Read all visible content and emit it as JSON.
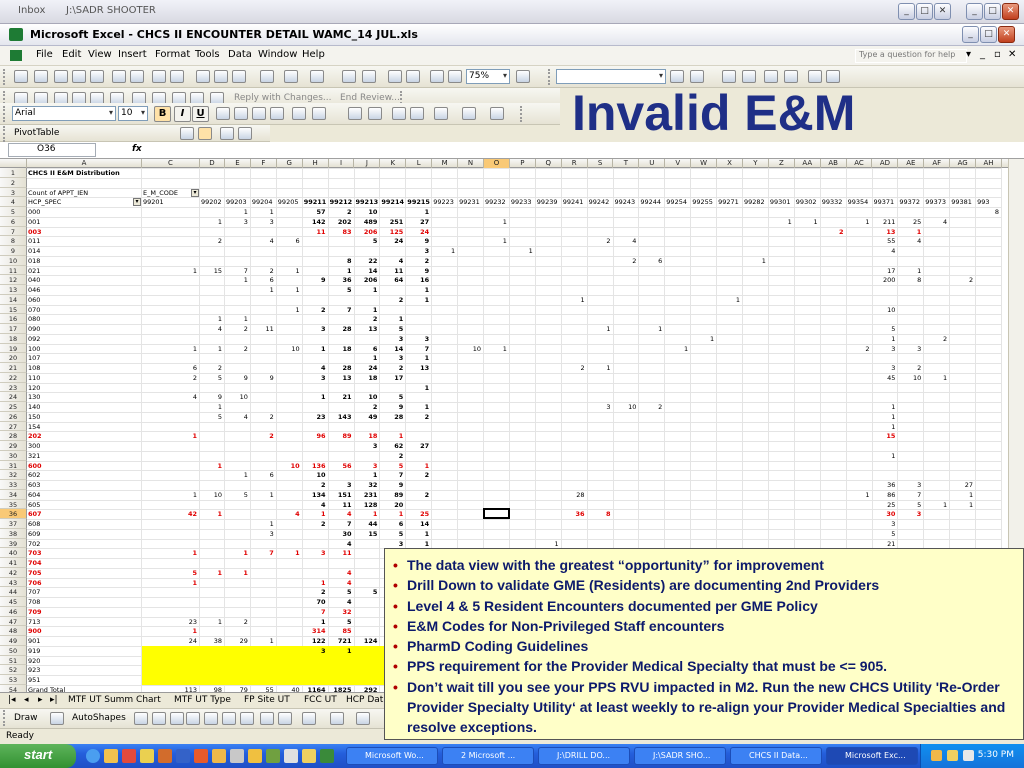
{
  "outer_window": {
    "title_inbox": "Inbox",
    "title": "J:\\SADR SHOOTER"
  },
  "excel_window": {
    "title": "Microsoft Excel - CHCS II ENCOUNTER DETAIL WAMC_14 JUL.xls"
  },
  "menu": {
    "items": [
      "File",
      "Edit",
      "View",
      "Insert",
      "Format",
      "Tools",
      "Data",
      "Window",
      "Help"
    ],
    "help_placeholder": "Type a question for help"
  },
  "toolbar": {
    "zoom": "75%",
    "font_name": "Arial",
    "font_size": "10",
    "reply_changes": "Reply with Changes...",
    "end_review": "End Review...",
    "pivot_table": "PivotTable"
  },
  "slide_title": "Invalid E&M",
  "formula_bar": {
    "name_box": "O36",
    "fx": "fx"
  },
  "grid": {
    "columns": [
      "A",
      "C",
      "D",
      "E",
      "F",
      "G",
      "H",
      "I",
      "J",
      "K",
      "L",
      "M",
      "N",
      "O",
      "P",
      "Q",
      "R",
      "S",
      "T",
      "U",
      "V",
      "W",
      "X",
      "Y",
      "Z",
      "AA",
      "AB",
      "AC",
      "AD",
      "AE",
      "AF",
      "AG",
      "AH"
    ],
    "active_col": "O",
    "active_row": "36",
    "header_cells": {
      "title": "CHCS II E&M Distribution",
      "count_label": "Count of APPT_IEN",
      "em_code": "E_M_CODE",
      "hcp_spec": "HCP_SPEC"
    },
    "codes": [
      "99201",
      "99202",
      "99203",
      "99204",
      "99205",
      "99211",
      "99212",
      "99213",
      "99214",
      "99215",
      "99223",
      "99231",
      "99232",
      "99233",
      "99239",
      "99241",
      "99242",
      "99243",
      "99244",
      "99254",
      "99255",
      "99271",
      "99282",
      "99301",
      "99302",
      "99332",
      "99354",
      "99371",
      "99372",
      "99373",
      "99381",
      "993"
    ],
    "rows": [
      {
        "r": "5",
        "a": "000",
        "v": {
          "E": "1",
          "F": "1",
          "H": "57",
          "I": "2",
          "J": "10",
          "L": "1",
          "AH": "8"
        }
      },
      {
        "r": "6",
        "a": "001",
        "v": {
          "D": "1",
          "E": "3",
          "F": "3",
          "H": "142",
          "I": "202",
          "J": "489",
          "K": "251",
          "L": "27",
          "O": "1",
          "Z": "1",
          "AA": "1",
          "AC": "1",
          "AD": "211",
          "AE": "25",
          "AF": "4"
        }
      },
      {
        "r": "7",
        "a": "003",
        "red": true,
        "v": {
          "H": "11",
          "I": "83",
          "J": "206",
          "K": "125",
          "L": "24",
          "AB": "2",
          "AD": "13",
          "AE": "1"
        }
      },
      {
        "r": "8",
        "a": "011",
        "v": {
          "D": "2",
          "F": "4",
          "G": "6",
          "J": "5",
          "K": "24",
          "L": "9",
          "O": "1",
          "S": "2",
          "T": "4",
          "AD": "55",
          "AE": "4"
        }
      },
      {
        "r": "9",
        "a": "014",
        "v": {
          "L": "3",
          "M": "1",
          "P": "1",
          "AD": "4"
        }
      },
      {
        "r": "10",
        "a": "018",
        "v": {
          "I": "8",
          "J": "22",
          "K": "4",
          "L": "2",
          "T": "2",
          "U": "6",
          "Y": "1"
        }
      },
      {
        "r": "11",
        "a": "021",
        "v": {
          "C": "1",
          "D": "15",
          "E": "7",
          "F": "2",
          "G": "1",
          "I": "1",
          "J": "14",
          "K": "11",
          "L": "9",
          "AD": "17",
          "AE": "1"
        }
      },
      {
        "r": "12",
        "a": "040",
        "v": {
          "E": "1",
          "F": "6",
          "H": "9",
          "I": "36",
          "J": "206",
          "K": "64",
          "L": "16",
          "AD": "200",
          "AE": "8",
          "AG": "2"
        }
      },
      {
        "r": "13",
        "a": "046",
        "v": {
          "F": "1",
          "G": "1",
          "I": "5",
          "J": "1",
          "L": "1"
        }
      },
      {
        "r": "14",
        "a": "060",
        "v": {
          "K": "2",
          "L": "1",
          "R": "1",
          "X": "1"
        }
      },
      {
        "r": "15",
        "a": "070",
        "v": {
          "G": "1",
          "H": "2",
          "I": "7",
          "J": "1",
          "AD": "10"
        }
      },
      {
        "r": "16",
        "a": "080",
        "v": {
          "D": "1",
          "E": "1",
          "J": "2",
          "K": "1"
        }
      },
      {
        "r": "17",
        "a": "090",
        "v": {
          "D": "4",
          "E": "2",
          "F": "11",
          "H": "3",
          "I": "28",
          "J": "13",
          "K": "5",
          "S": "1",
          "U": "1",
          "AD": "5"
        }
      },
      {
        "r": "18",
        "a": "092",
        "v": {
          "K": "3",
          "L": "3",
          "W": "1",
          "AD": "1",
          "AF": "2"
        }
      },
      {
        "r": "19",
        "a": "100",
        "v": {
          "C": "1",
          "D": "1",
          "E": "2",
          "G": "10",
          "H": "1",
          "I": "18",
          "J": "6",
          "K": "14",
          "L": "7",
          "N": "10",
          "O": "1",
          "V": "1",
          "AC": "2",
          "AD": "3",
          "AE": "3"
        }
      },
      {
        "r": "20",
        "a": "107",
        "v": {
          "J": "1",
          "K": "3",
          "L": "1"
        }
      },
      {
        "r": "21",
        "a": "108",
        "v": {
          "C": "6",
          "D": "2",
          "H": "4",
          "I": "28",
          "J": "24",
          "K": "2",
          "L": "13",
          "R": "2",
          "S": "1",
          "AD": "3",
          "AE": "2"
        }
      },
      {
        "r": "22",
        "a": "110",
        "v": {
          "C": "2",
          "D": "5",
          "E": "9",
          "F": "9",
          "H": "3",
          "I": "13",
          "J": "18",
          "K": "17",
          "AD": "45",
          "AE": "10",
          "AF": "1"
        }
      },
      {
        "r": "23",
        "a": "120",
        "v": {
          "L": "1"
        }
      },
      {
        "r": "24",
        "a": "130",
        "v": {
          "C": "4",
          "D": "9",
          "E": "10",
          "H": "1",
          "I": "21",
          "J": "10",
          "K": "5"
        }
      },
      {
        "r": "25",
        "a": "140",
        "v": {
          "D": "1",
          "J": "2",
          "K": "9",
          "L": "1",
          "S": "3",
          "T": "10",
          "U": "2",
          "AD": "1"
        }
      },
      {
        "r": "26",
        "a": "150",
        "v": {
          "D": "5",
          "E": "4",
          "F": "2",
          "H": "23",
          "I": "143",
          "J": "49",
          "K": "28",
          "L": "2",
          "AD": "1"
        }
      },
      {
        "r": "27",
        "a": "154",
        "v": {
          "AD": "1"
        }
      },
      {
        "r": "28",
        "a": "202",
        "red": true,
        "v": {
          "C": "1",
          "F": "2",
          "H": "96",
          "I": "89",
          "J": "18",
          "K": "1",
          "AD": "15"
        }
      },
      {
        "r": "29",
        "a": "300",
        "v": {
          "J": "3",
          "K": "62",
          "L": "27"
        }
      },
      {
        "r": "30",
        "a": "321",
        "v": {
          "K": "2",
          "AD": "1"
        }
      },
      {
        "r": "31",
        "a": "600",
        "red": true,
        "v": {
          "D": "1",
          "G": "10",
          "H": "136",
          "I": "56",
          "J": "3",
          "K": "5",
          "L": "1"
        }
      },
      {
        "r": "32",
        "a": "602",
        "v": {
          "E": "1",
          "F": "6",
          "H": "10",
          "J": "1",
          "K": "7",
          "L": "2"
        }
      },
      {
        "r": "33",
        "a": "603",
        "v": {
          "H": "2",
          "I": "3",
          "J": "32",
          "K": "9",
          "AD": "36",
          "AE": "3",
          "AG": "27"
        }
      },
      {
        "r": "34",
        "a": "604",
        "v": {
          "C": "1",
          "D": "10",
          "E": "5",
          "F": "1",
          "H": "134",
          "I": "151",
          "J": "231",
          "K": "89",
          "L": "2",
          "R": "28",
          "AC": "1",
          "AD": "86",
          "AE": "7",
          "AG": "1"
        }
      },
      {
        "r": "35",
        "a": "605",
        "v": {
          "H": "4",
          "I": "11",
          "J": "128",
          "K": "20",
          "AD": "25",
          "AE": "5",
          "AF": "1",
          "AG": "1"
        }
      },
      {
        "r": "36",
        "a": "607",
        "red": true,
        "v": {
          "C": "42",
          "D": "1",
          "G": "4",
          "H": "1",
          "I": "4",
          "J": "1",
          "K": "1",
          "L": "25",
          "R": "36",
          "S": "8",
          "AD": "30",
          "AE": "3"
        }
      },
      {
        "r": "37",
        "a": "608",
        "v": {
          "F": "1",
          "H": "2",
          "I": "7",
          "J": "44",
          "K": "6",
          "L": "14",
          "AD": "3"
        }
      },
      {
        "r": "38",
        "a": "609",
        "v": {
          "F": "3",
          "I": "30",
          "J": "15",
          "K": "5",
          "L": "1",
          "AD": "5"
        }
      },
      {
        "r": "39",
        "a": "702",
        "v": {
          "I": "4",
          "K": "3",
          "L": "1",
          "Q": "1",
          "AD": "21"
        }
      },
      {
        "r": "40",
        "a": "703",
        "red": true,
        "v": {
          "C": "1",
          "E": "1",
          "F": "7",
          "G": "1",
          "H": "3",
          "I": "11"
        }
      },
      {
        "r": "41",
        "a": "704",
        "red": true,
        "v": {}
      },
      {
        "r": "42",
        "a": "705",
        "red": true,
        "v": {
          "C": "5",
          "D": "1",
          "E": "1",
          "I": "4"
        }
      },
      {
        "r": "43",
        "a": "706",
        "red": true,
        "v": {
          "C": "1",
          "H": "1",
          "I": "4"
        }
      },
      {
        "r": "44",
        "a": "707",
        "v": {
          "H": "2",
          "I": "5",
          "J": "5"
        }
      },
      {
        "r": "45",
        "a": "708",
        "v": {
          "H": "70",
          "I": "4"
        }
      },
      {
        "r": "46",
        "a": "709",
        "red": true,
        "v": {
          "H": "7",
          "I": "32"
        }
      },
      {
        "r": "47",
        "a": "713",
        "v": {
          "C": "23",
          "D": "1",
          "E": "2",
          "H": "1",
          "I": "5"
        }
      },
      {
        "r": "48",
        "a": "900",
        "red": true,
        "v": {
          "C": "1",
          "H": "314",
          "I": "85"
        }
      },
      {
        "r": "49",
        "a": "901",
        "v": {
          "C": "24",
          "D": "38",
          "E": "29",
          "F": "1",
          "H": "122",
          "I": "721",
          "J": "124"
        }
      },
      {
        "r": "50",
        "a": "919",
        "yellow": true,
        "v": {
          "H": "3",
          "I": "1"
        }
      },
      {
        "r": "51",
        "a": "920",
        "yellow": true,
        "v": {}
      },
      {
        "r": "52",
        "a": "923",
        "yellow": true,
        "v": {}
      },
      {
        "r": "53",
        "a": "951",
        "yellow": true,
        "v": {}
      },
      {
        "r": "54",
        "a": "Grand Total",
        "v": {
          "C": "113",
          "D": "98",
          "E": "79",
          "F": "55",
          "G": "40",
          "H": "1164",
          "I": "1825",
          "J": "292"
        }
      }
    ]
  },
  "sheet_tabs": [
    "MTF UT Summ Chart",
    "MTF UT Type",
    "FP Site UT",
    "FCC UT",
    "HCP Dat"
  ],
  "drawing_toolbar": {
    "draw": "Draw",
    "autoshapes": "AutoShapes"
  },
  "status": "Ready",
  "callout": {
    "bullets": [
      "The data view with the greatest “opportunity” for improvement",
      "Drill Down to validate GME (Residents) are documenting 2nd Providers",
      "Level 4 & 5 Resident Encounters documented per GME Policy",
      "E&M Codes for Non-Privileged Staff encounters",
      "PharmD Coding Guidelines",
      "PPS requirement for the Provider Medical Specialty that must be <= 905.",
      "Don’t wait till you see your PPS RVU impacted in M2.  Run the new CHCS Utility 'Re-Order Provider Specialty Utility‘ at least weekly to re-align your Provider Medical Specialties and resolve exceptions."
    ]
  },
  "taskbar": {
    "start": "start",
    "tasks": [
      "Microsoft Wo...",
      "2 Microsoft ...",
      "J:\\DRILL DO...",
      "J:\\SADR SHO...",
      "CHCS II Data...",
      "Microsoft Exc..."
    ],
    "clock": "5:30 PM"
  }
}
